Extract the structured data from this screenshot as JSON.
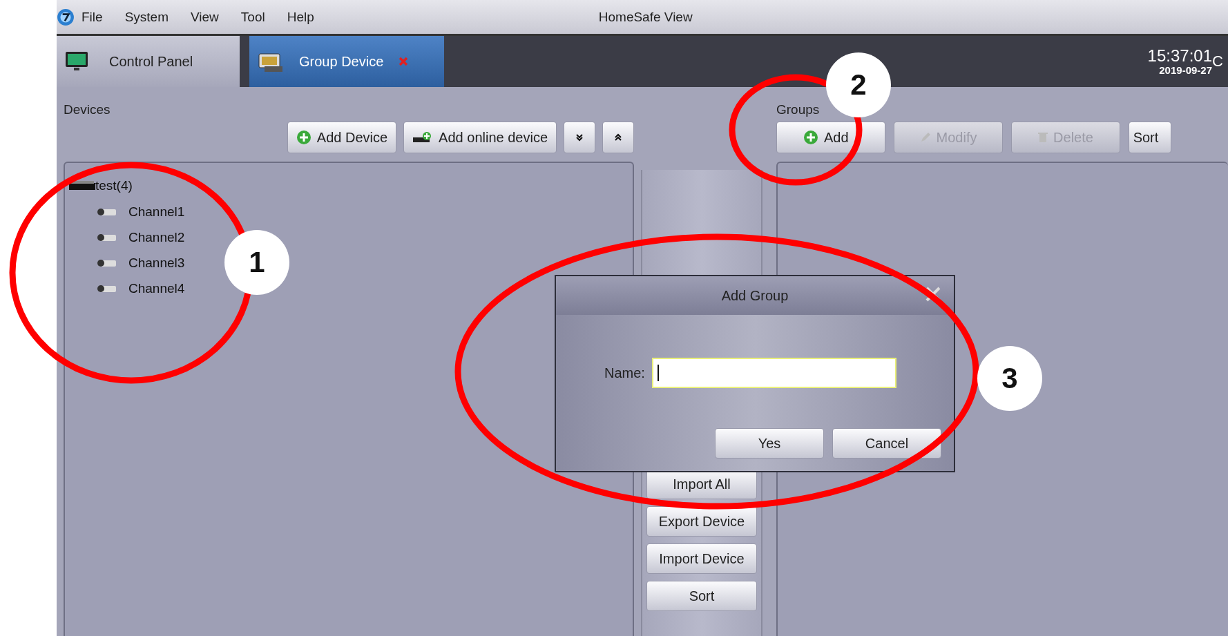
{
  "window": {
    "title": "HomeSafe View"
  },
  "menu": [
    "File",
    "System",
    "View",
    "Tool",
    "Help"
  ],
  "tabs": [
    {
      "label": "Control Panel",
      "selected": false,
      "closable": false
    },
    {
      "label": "Group Device",
      "selected": true,
      "closable": true
    }
  ],
  "clock": {
    "time": "15:37:01",
    "date": "2019-09-27",
    "cut_text": "C"
  },
  "devices": {
    "title": "Devices",
    "toolbar": [
      {
        "kind": "add",
        "label": "Add Device"
      },
      {
        "kind": "online",
        "label": "Add online device"
      },
      {
        "kind": "expand"
      },
      {
        "kind": "collapse"
      }
    ],
    "tree": [
      {
        "label": "test(4)",
        "children": [
          {
            "label": "Channel1"
          },
          {
            "label": "Channel2"
          },
          {
            "label": "Channel3"
          },
          {
            "label": "Channel4"
          }
        ]
      }
    ]
  },
  "middle_buttons": [
    "Import All",
    "Export Device",
    "Import Device",
    "Sort"
  ],
  "groups": {
    "title": "Groups",
    "toolbar": [
      {
        "kind": "add",
        "label": "Add",
        "disabled": false
      },
      {
        "kind": "edit",
        "label": "Modify",
        "disabled": true
      },
      {
        "kind": "trash",
        "label": "Delete",
        "disabled": true
      },
      {
        "kind": "text",
        "label": "Sort",
        "disabled": false
      }
    ]
  },
  "dialog": {
    "title": "Add Group",
    "field_label": "Name:",
    "focused": true,
    "buttons": [
      "Yes",
      "Cancel"
    ]
  },
  "annotations": [
    {
      "label": "1"
    },
    {
      "label": "2"
    },
    {
      "label": "3"
    }
  ]
}
